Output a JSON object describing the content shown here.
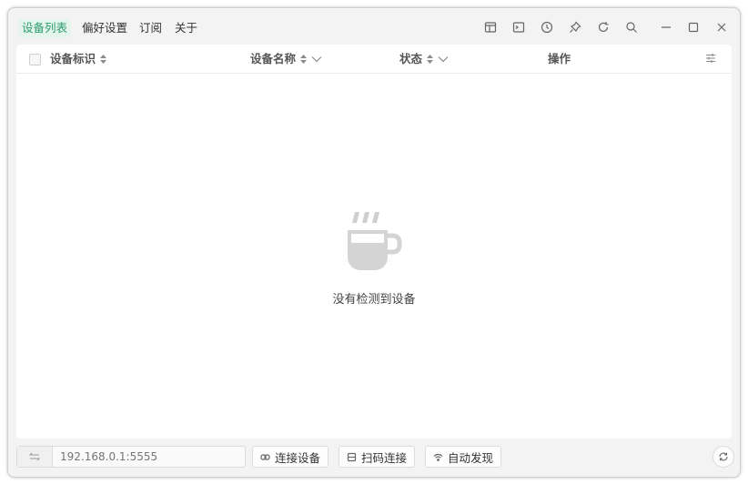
{
  "menu": {
    "items": [
      {
        "label": "设备列表",
        "active": true
      },
      {
        "label": "偏好设置"
      },
      {
        "label": "订阅"
      },
      {
        "label": "关于"
      }
    ]
  },
  "toolbar_icons": [
    "layout-icon",
    "terminal-icon",
    "clock-icon",
    "pin-icon",
    "refresh-icon",
    "search-icon",
    "minimize-icon",
    "maximize-icon",
    "close-icon"
  ],
  "table": {
    "columns": [
      "设备标识",
      "设备名称",
      "状态",
      "操作"
    ]
  },
  "empty_state": {
    "text": "没有检测到设备"
  },
  "bottom": {
    "address_placeholder": "192.168.0.1:5555",
    "connect_label": "连接设备",
    "scan_label": "扫码连接",
    "discover_label": "自动发现"
  },
  "colors": {
    "accent": "#2a9d6f",
    "window_bg": "#f3f3f3",
    "panel_bg": "#ffffff"
  }
}
